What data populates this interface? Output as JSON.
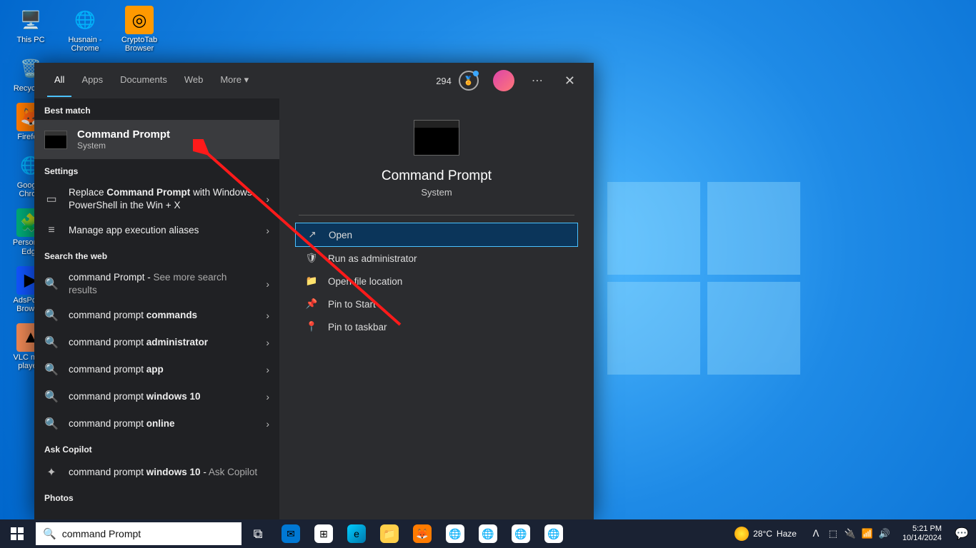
{
  "desktop": {
    "icons_col1": [
      {
        "label": "This PC",
        "emoji": "🖥️",
        "bg": ""
      },
      {
        "label": "Recycle...",
        "emoji": "🗑️",
        "bg": ""
      },
      {
        "label": "Firefo...",
        "emoji": "🦊",
        "bg": "#ff7b00"
      },
      {
        "label": "Googl... Chro...",
        "emoji": "🌐",
        "bg": ""
      },
      {
        "label": "Persona... Edge",
        "emoji": "🧩",
        "bg": "#0a7"
      },
      {
        "label": "AdsPow... Brows...",
        "emoji": "▶",
        "bg": "#15f"
      },
      {
        "label": "VLC me... playe...",
        "emoji": "▲",
        "bg": "#e85"
      }
    ],
    "icons_col2": [
      {
        "label": "Husnain - Chrome",
        "emoji": "🌐",
        "bg": ""
      }
    ],
    "icons_col3": [
      {
        "label": "CryptoTab Browser",
        "emoji": "◎",
        "bg": "#f90"
      }
    ]
  },
  "search": {
    "tabs": [
      "All",
      "Apps",
      "Documents",
      "Web",
      "More ▾"
    ],
    "active_tab": 0,
    "count": "294",
    "best_label": "Best match",
    "best": {
      "title": "Command Prompt",
      "subtitle": "System"
    },
    "settings_label": "Settings",
    "settings": [
      {
        "icon": "▭",
        "html": "Replace <b>Command Prompt</b> with Windows PowerShell in the Win + X",
        "chev": "›"
      },
      {
        "icon": "≡",
        "html": "Manage app execution aliases",
        "chev": "›"
      }
    ],
    "web_label": "Search the web",
    "web": [
      {
        "html": "command Prompt - <span style='color:#aaa'>See more search results</span>"
      },
      {
        "html": "command prompt <b>commands</b>"
      },
      {
        "html": "command prompt <b>administrator</b>"
      },
      {
        "html": "command prompt <b>app</b>"
      },
      {
        "html": "command prompt <b>windows 10</b>"
      },
      {
        "html": "command prompt <b>online</b>"
      }
    ],
    "copilot_label": "Ask Copilot",
    "copilot": {
      "html": "command prompt <b>windows 10</b> - <span style='color:#aaa'>Ask Copilot</span>"
    },
    "photos_label": "Photos",
    "right": {
      "title": "Command Prompt",
      "subtitle": "System",
      "actions": [
        {
          "icon": "↗",
          "label": "Open",
          "selected": true
        },
        {
          "icon": "🛡",
          "label": "Run as administrator"
        },
        {
          "icon": "📁",
          "label": "Open file location"
        },
        {
          "icon": "📌",
          "label": "Pin to Start"
        },
        {
          "icon": "📍",
          "label": "Pin to taskbar"
        }
      ]
    }
  },
  "taskbar": {
    "search_value": "command Prompt",
    "apps": [
      {
        "bg": "#0078d4",
        "txt": "✉"
      },
      {
        "bg": "#fff",
        "txt": "⊞"
      },
      {
        "bg": "linear-gradient(135deg,#0cf,#07a)",
        "txt": "e"
      },
      {
        "bg": "#ffcf4a",
        "txt": "📁"
      },
      {
        "bg": "#ff7b00",
        "txt": "🦊"
      },
      {
        "bg": "#fff",
        "txt": "🌐"
      },
      {
        "bg": "#fff",
        "txt": "🌐"
      },
      {
        "bg": "#fff",
        "txt": "🌐"
      },
      {
        "bg": "#fff",
        "txt": "🌐"
      }
    ],
    "weather_temp": "28°C",
    "weather_cond": "Haze",
    "tray": [
      "ᐱ",
      "⬚",
      "🔌",
      "📶",
      "🔊"
    ],
    "time": "5:21 PM",
    "date": "10/14/2024"
  }
}
